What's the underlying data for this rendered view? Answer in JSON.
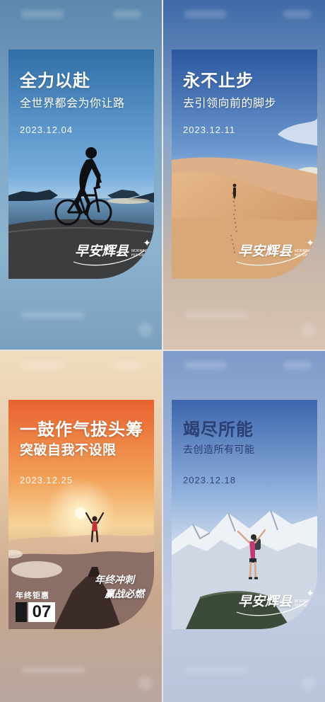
{
  "posters": [
    {
      "title": "全力以赴",
      "subtitle": "全世界都会为你让路",
      "date": "2023.12.04",
      "logo_text": "早安辉县",
      "logo_en": "MORNING\nHUI XIAN",
      "scene": "cyclist-silhouette-icon"
    },
    {
      "title": "永不止步",
      "subtitle": "去引领向前的脚步",
      "date": "2023.12.11",
      "logo_text": "早安辉县",
      "logo_en": "MORNING\nHUI XIAN",
      "scene": "desert-walker-icon"
    },
    {
      "title": "一鼓作气拔头筹",
      "subtitle": "突破自我不设限",
      "date": "2023.12.25",
      "scene": "mountain-summit-icon",
      "badge_title": "年终钜惠",
      "badge_number": "07",
      "slogan_line1": "年终冲刺",
      "slogan_line2": "赢战必燃"
    },
    {
      "title": "竭尽所能",
      "subtitle": "去创造所有可能",
      "date": "2023.12.18",
      "logo_text": "早安辉县",
      "logo_en": "MORNING\nHUI XIAN",
      "scene": "hiker-raised-arms-icon"
    }
  ],
  "colors": {
    "text": "#ffffff",
    "sky_blue": "#5d88ad",
    "sunset_orange": "#e8894b",
    "sand": "#d9a678"
  }
}
